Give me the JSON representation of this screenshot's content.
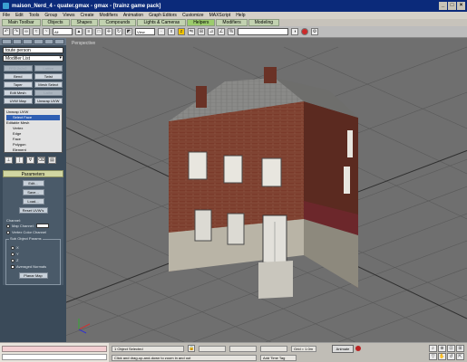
{
  "window": {
    "title": "maison_Nerd_4 - quater.gmax - gmax - [trainz game pack]"
  },
  "menu": [
    "File",
    "Edit",
    "Tools",
    "Group",
    "Views",
    "Create",
    "Modifiers",
    "Animation",
    "Graph Editors",
    "Customize",
    "MAXScript",
    "Help"
  ],
  "tabs": [
    "Main Toolbar",
    "Objects",
    "Shapes",
    "Compounds",
    "Lights & Cameras",
    "Helpers",
    "Modifiers",
    "Modeling"
  ],
  "active_tab_index": 5,
  "toolbar": {
    "selection_filter": "All",
    "view_mode": "View"
  },
  "panel": {
    "object_name": "toute person",
    "modifier_list": "Modifier List",
    "mod_buttons": [
      {
        "label": "FFD 2x2x2",
        "enabled": false
      },
      {
        "label": "Lattice",
        "enabled": false
      },
      {
        "label": "Bend",
        "enabled": true
      },
      {
        "label": "Twist",
        "enabled": true
      },
      {
        "label": "Taper",
        "enabled": true
      },
      {
        "label": "Mesh Select",
        "enabled": true
      },
      {
        "label": "Edit Mesh",
        "enabled": true
      },
      {
        "label": "Lathe",
        "enabled": false
      },
      {
        "label": "UVW Map",
        "enabled": true
      },
      {
        "label": "Unwrap UVW",
        "enabled": true
      }
    ],
    "stack": [
      {
        "label": "Unwrap UVW",
        "level": 0,
        "selected": false
      },
      {
        "label": "Select Face",
        "level": 1,
        "selected": true
      },
      {
        "label": "Editable Mesh",
        "level": 0,
        "selected": false
      },
      {
        "label": "Vertex",
        "level": 1,
        "selected": false
      },
      {
        "label": "Edge",
        "level": 1,
        "selected": false
      },
      {
        "label": "Face",
        "level": 1,
        "selected": false
      },
      {
        "label": "Polygon",
        "level": 1,
        "selected": false
      },
      {
        "label": "Element",
        "level": 1,
        "selected": false
      }
    ],
    "parameters": {
      "title": "Parameters",
      "edit": "Edit...",
      "save": "Save...",
      "load": "Load...",
      "reset": "Reset UVW's",
      "channel_label": "Channel:",
      "map_channel": "Map Channel:",
      "vertex_color": "Vertex Color Channel",
      "subobject_title": "Sub Object Params",
      "axis_x": "X",
      "axis_y": "Y",
      "axis_z": "Z",
      "averaged": "Averaged Normals",
      "planar": "Planar Map"
    }
  },
  "viewport": {
    "label": "Perspective"
  },
  "status": {
    "selected": "1 Object Selected",
    "prompt": "Click and drag-up-and-down to zoom in and out",
    "grid": "Grid = 1.0m",
    "add_time_tag": "Add Time Tag",
    "animate": "Animate"
  },
  "colors": {
    "title_bar": "#0b2a7a",
    "panel": "#3a4a59",
    "viewport": "#6f6f6f",
    "brick": "#7a3a2a",
    "roof": "#8a8a88"
  }
}
